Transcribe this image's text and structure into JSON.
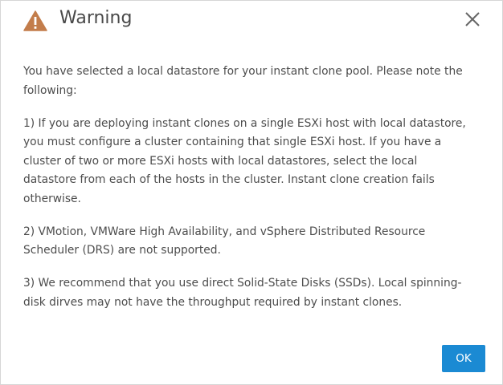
{
  "dialog": {
    "title": "Warning",
    "icon": "warning-triangle-icon",
    "accent_color": "#c37d4b",
    "paragraphs": [
      "You have selected a local datastore for your instant clone pool. Please note the following:",
      "1) If you are deploying instant clones on a single ESXi host with local datastore, you must configure a cluster containing that single ESXi host. If you have a cluster of two or more ESXi hosts with local datastores, select the local datastore from each of the hosts in the cluster. Instant clone creation fails otherwise.",
      "2) VMotion, VMWare High Availability, and vSphere Distributed Resource Scheduler (DRS) are not supported.",
      "3) We recommend that you use direct Solid-State Disks (SSDs). Local spinning-disk dirves may not have the throughput required by instant clones."
    ],
    "ok_label": "OK",
    "ok_color": "#1b8ad3"
  }
}
